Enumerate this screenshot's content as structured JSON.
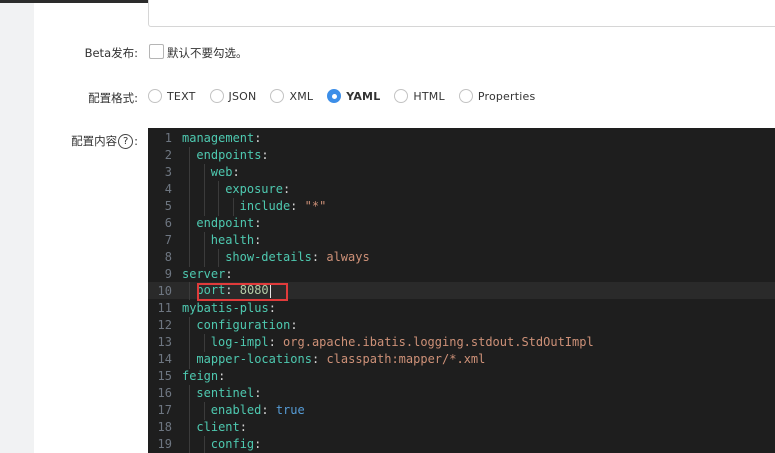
{
  "beta": {
    "label": "Beta发布:",
    "checkbox_text": "默认不要勾选。"
  },
  "format": {
    "label": "配置格式:",
    "options": [
      "TEXT",
      "JSON",
      "XML",
      "YAML",
      "HTML",
      "Properties"
    ],
    "selected": "YAML"
  },
  "content": {
    "label_prefix": "配置内容",
    "help_icon": "?",
    "label_suffix": ":"
  },
  "editor": {
    "lines": [
      {
        "n": "1",
        "key": "management",
        "sep": ":",
        "value": ""
      },
      {
        "n": "2",
        "key": "endpoints",
        "sep": ":",
        "value": ""
      },
      {
        "n": "3",
        "key": "web",
        "sep": ":",
        "value": ""
      },
      {
        "n": "4",
        "key": "exposure",
        "sep": ":",
        "value": ""
      },
      {
        "n": "5",
        "key": "include",
        "sep": ": ",
        "value": "\"*\""
      },
      {
        "n": "6",
        "key": "endpoint",
        "sep": ":",
        "value": ""
      },
      {
        "n": "7",
        "key": "health",
        "sep": ":",
        "value": ""
      },
      {
        "n": "8",
        "key": "show-details",
        "sep": ": ",
        "value": "always"
      },
      {
        "n": "9",
        "key": "server",
        "sep": ":",
        "value": ""
      },
      {
        "n": "10",
        "key": "port",
        "sep": ": ",
        "value": "8080"
      },
      {
        "n": "11",
        "key": "mybatis-plus",
        "sep": ":",
        "value": ""
      },
      {
        "n": "12",
        "key": "configuration",
        "sep": ":",
        "value": ""
      },
      {
        "n": "13",
        "key": "log-impl",
        "sep": ": ",
        "value": "org.apache.ibatis.logging.stdout.StdOutImpl"
      },
      {
        "n": "14",
        "key": "mapper-locations",
        "sep": ": ",
        "value": "classpath:mapper/*.xml"
      },
      {
        "n": "15",
        "key": "feign",
        "sep": ":",
        "value": ""
      },
      {
        "n": "16",
        "key": "sentinel",
        "sep": ":",
        "value": ""
      },
      {
        "n": "17",
        "key": "enabled",
        "sep": ": ",
        "value": "true"
      },
      {
        "n": "18",
        "key": "client",
        "sep": ":",
        "value": ""
      },
      {
        "n": "19",
        "key": "config",
        "sep": ":",
        "value": ""
      }
    ]
  },
  "colors": {
    "accent": "#3c8ee8",
    "highlight": "#e03b3b",
    "editor_bg": "#1e1e1e"
  }
}
